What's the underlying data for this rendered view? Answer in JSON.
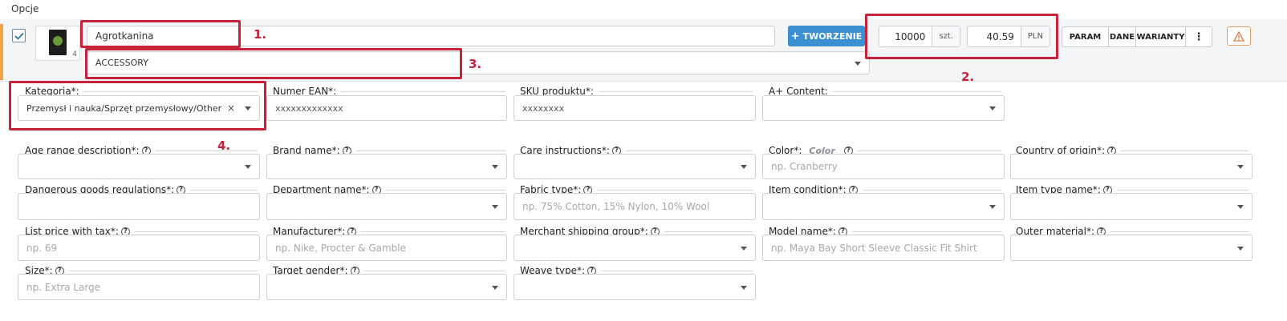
{
  "header": {
    "title": "Opcje"
  },
  "product": {
    "thumb_count": "4",
    "name_value": "Agrotkanina",
    "category_select_value": "ACCESSORY",
    "create_button_label": "TWORZENIE",
    "quantity": {
      "value": "10000",
      "unit": "szt."
    },
    "price": {
      "value": "40.59",
      "currency": "PLN"
    },
    "actions": [
      "PARAM",
      "DANE",
      "WARIANTY",
      "⋮"
    ]
  },
  "annotations": {
    "a1": "1.",
    "a2": "2.",
    "a3": "3.",
    "a4": "4."
  },
  "top_fields": {
    "kategoria": {
      "label": "Kategoria*:",
      "value": "Przemysł i nauka/Sprzęt przemysłowy/Other",
      "clear": "×"
    },
    "ean": {
      "label": "Numer EAN*:",
      "value": "xxxxxxxxxxxxx"
    },
    "sku": {
      "label": "SKU produktu*:",
      "value": "xxxxxxxx"
    },
    "aplus": {
      "label": "A+ Content:"
    }
  },
  "fields": {
    "age_range": {
      "label": "Age range description*:"
    },
    "brand": {
      "label": "Brand name*:"
    },
    "care": {
      "label": "Care instructions*:"
    },
    "color": {
      "label": "Color*:",
      "hint": "Color",
      "placeholder": "np. Cranberry"
    },
    "country": {
      "label": "Country of origin*:"
    },
    "dangerous": {
      "label": "Dangerous goods regulations*:"
    },
    "department": {
      "label": "Department name*:"
    },
    "fabric": {
      "label": "Fabric type*:",
      "placeholder": "np. 75% Cotton, 15% Nylon, 10% Wool"
    },
    "condition": {
      "label": "Item condition*:"
    },
    "item_type": {
      "label": "Item type name*:"
    },
    "list_price": {
      "label": "List price with tax*:",
      "placeholder": "np. 69"
    },
    "manufacturer": {
      "label": "Manufacturer*:",
      "placeholder": "np. Nike, Procter & Gamble"
    },
    "shipping": {
      "label": "Merchant shipping group*:"
    },
    "model": {
      "label": "Model name*:",
      "placeholder": "np. Maya Bay Short Sleeve Classic Fit Shirt"
    },
    "outer": {
      "label": "Outer material*:"
    },
    "size": {
      "label": "Size*:",
      "placeholder": "np. Extra Large"
    },
    "gender": {
      "label": "Target gender*:"
    },
    "weave": {
      "label": "Weave type*:"
    }
  },
  "colors": {
    "accent": "#3a90d0",
    "annotation": "#c6233b",
    "edge": "#f0a34a"
  }
}
